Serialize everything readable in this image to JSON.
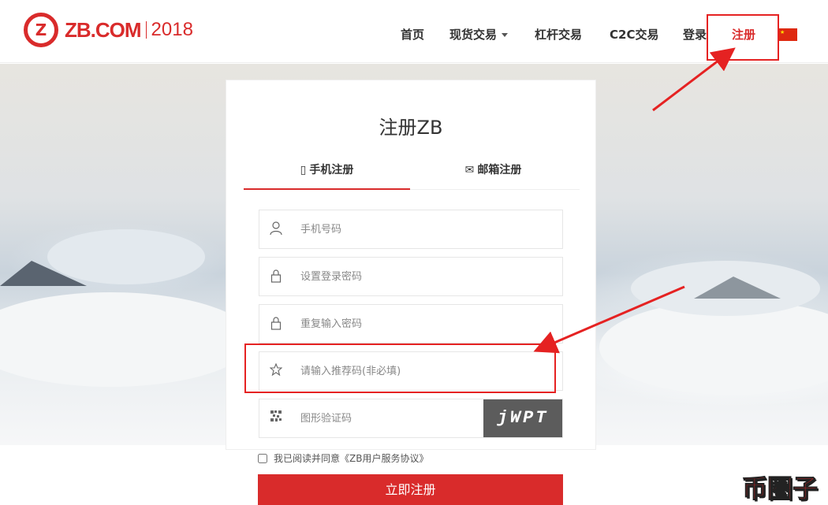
{
  "header": {
    "logo_text": "ZB.COM",
    "logo_year": "2018",
    "nav": [
      {
        "label": "首页"
      },
      {
        "label": "现货交易"
      },
      {
        "label": "杠杆交易"
      },
      {
        "label": "C2C交易"
      },
      {
        "label": "登录"
      },
      {
        "label": "注册"
      }
    ]
  },
  "form": {
    "title": "注册ZB",
    "tabs": [
      {
        "label": "手机注册",
        "active": true
      },
      {
        "label": "邮箱注册",
        "active": false
      }
    ],
    "fields": {
      "phone_placeholder": "手机号码",
      "password_placeholder": "设置登录密码",
      "repeat_password_placeholder": "重复输入密码",
      "referral_placeholder": "请输入推荐码(非必填)",
      "captcha_placeholder": "图形验证码"
    },
    "captcha_text": "jWPT",
    "agreement": "我已阅读并同意《ZB用户服务协议》",
    "submit_label": "立即注册"
  },
  "watermark": "币圈子",
  "colors": {
    "accent": "#d92b2b",
    "annotation": "#e52222"
  }
}
